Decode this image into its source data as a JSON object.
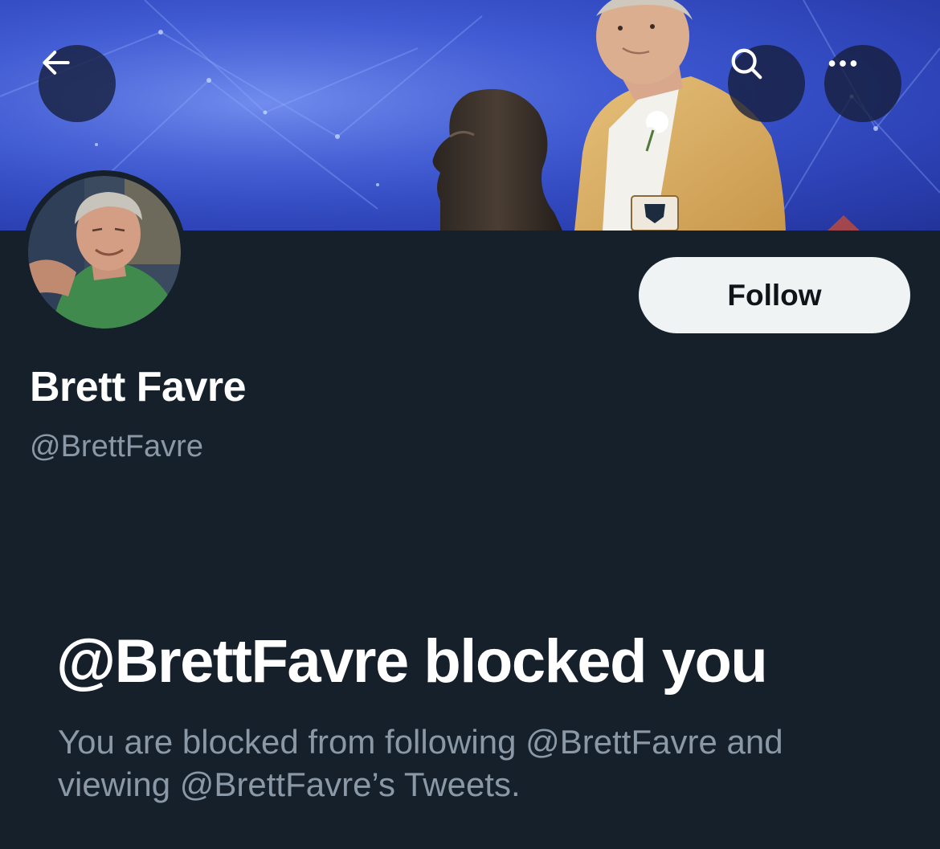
{
  "header": {
    "back_icon": "arrow-left-icon",
    "search_icon": "search-icon",
    "more_icon": "more-horizontal-icon"
  },
  "profile": {
    "display_name": "Brett Favre",
    "handle": "@BrettFavre",
    "follow_label": "Follow"
  },
  "blocked": {
    "title": "@BrettFavre blocked you",
    "description": "You are blocked from following @BrettFavre and viewing @BrettFavre’s Tweets."
  },
  "colors": {
    "background": "#15202b",
    "primary_text": "#ffffff",
    "secondary_text": "#8b98a5",
    "follow_button": "#eff3f4"
  }
}
